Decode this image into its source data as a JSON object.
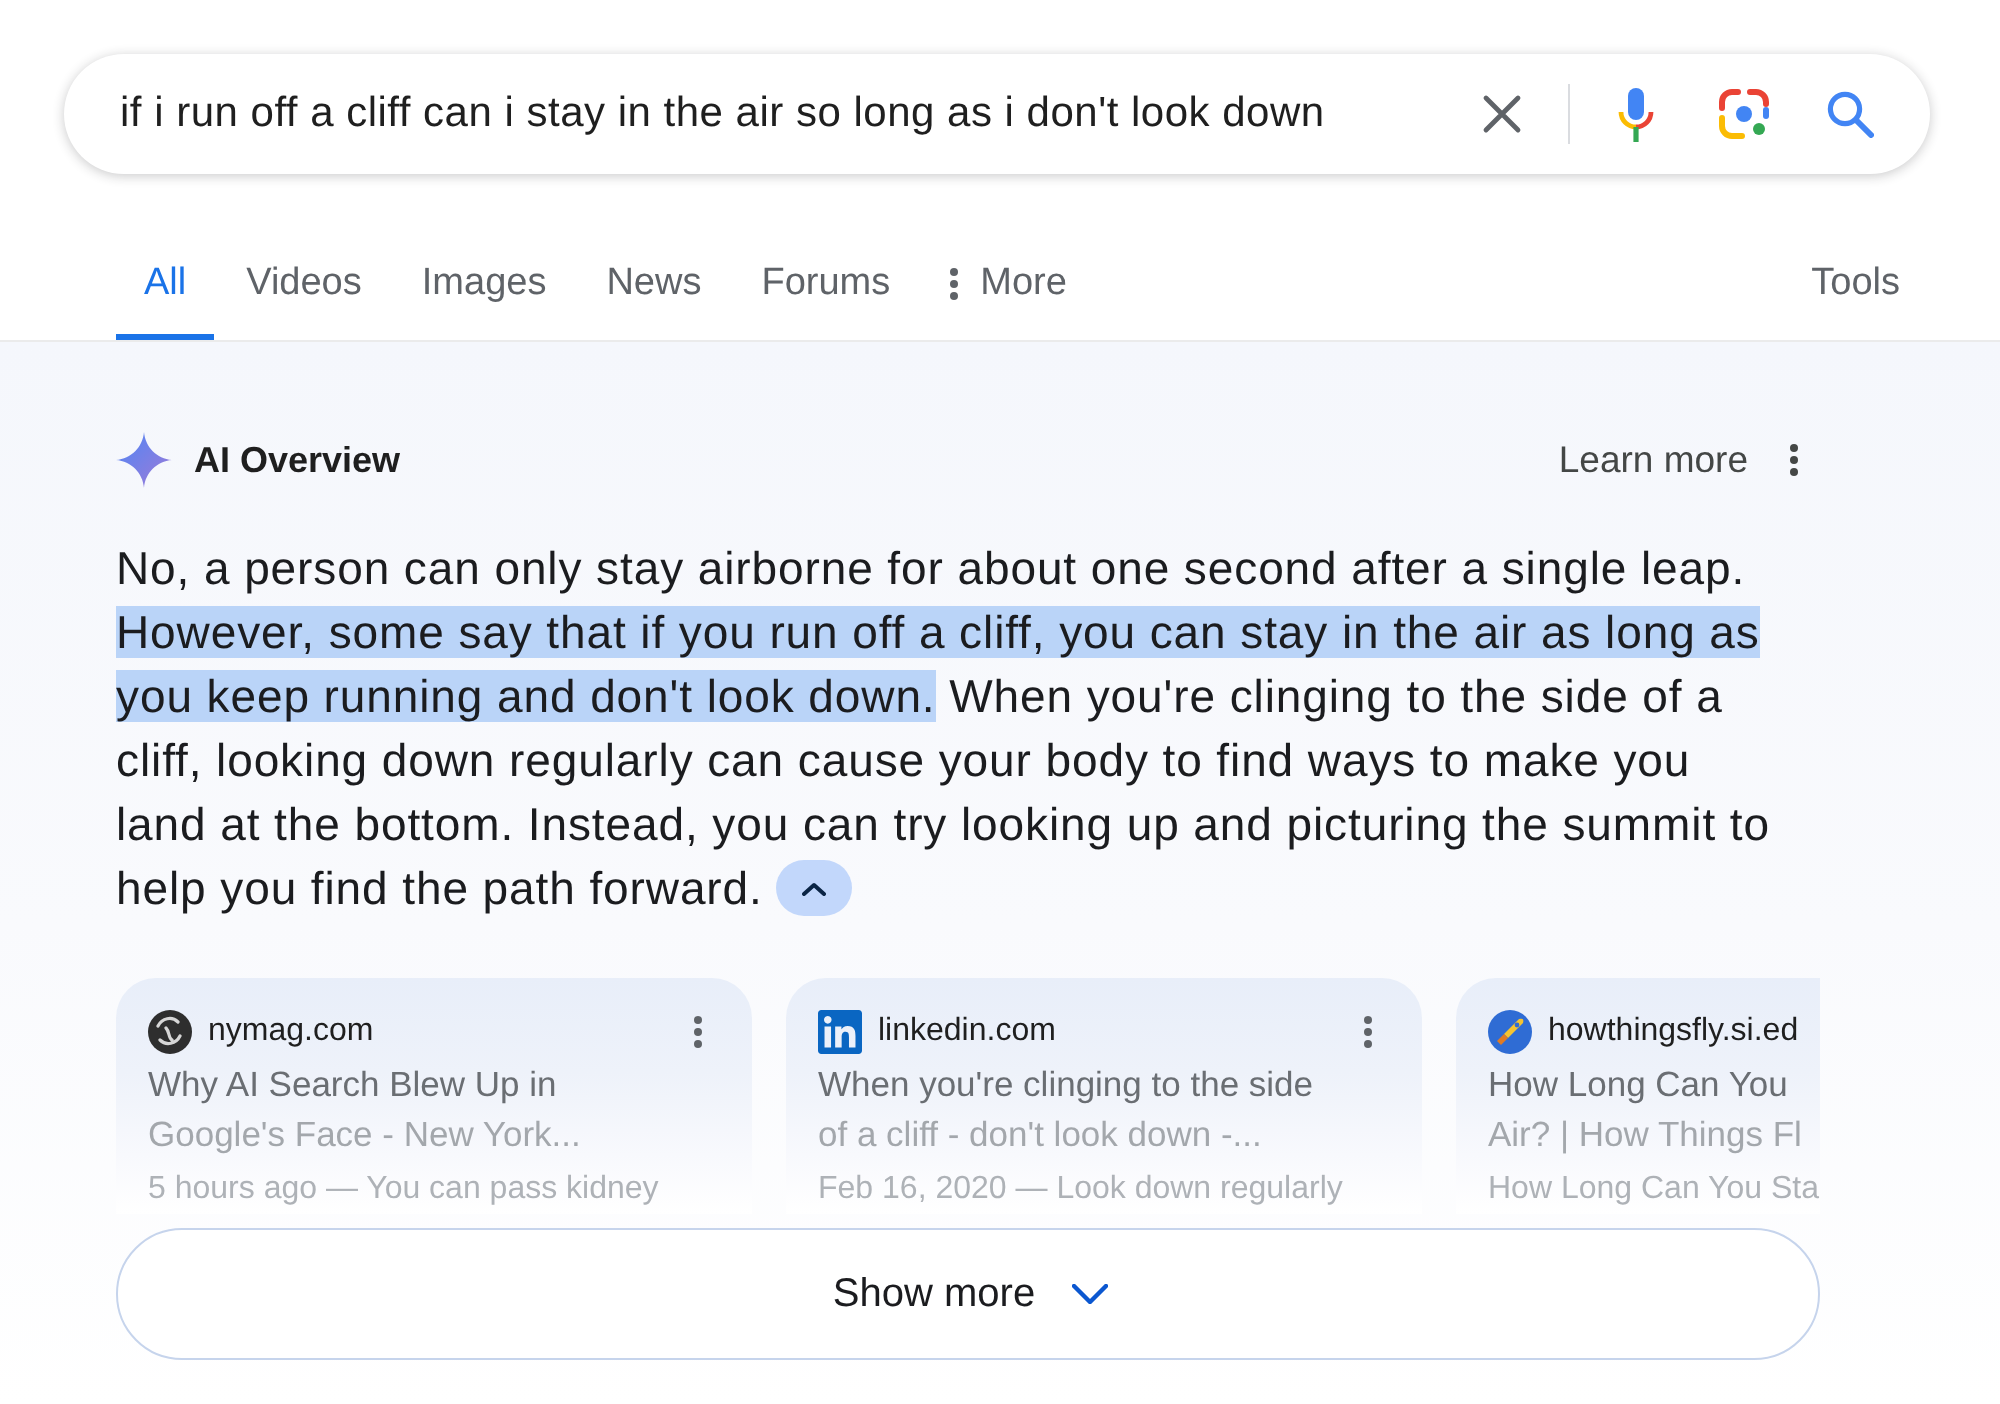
{
  "search": {
    "value": "if i run off a cliff can i stay in the air so long as i don't look down"
  },
  "tabs": [
    {
      "label": "All",
      "selected": true,
      "kind": "plain"
    },
    {
      "label": "Videos",
      "selected": false,
      "kind": "plain"
    },
    {
      "label": "Images",
      "selected": false,
      "kind": "plain"
    },
    {
      "label": "News",
      "selected": false,
      "kind": "plain"
    },
    {
      "label": "Forums",
      "selected": false,
      "kind": "plain"
    },
    {
      "label": "More",
      "selected": false,
      "kind": "menu"
    }
  ],
  "tools": "Tools",
  "overview": {
    "title": "AI Overview",
    "learn_more": "Learn more",
    "segments": [
      {
        "text": "No, a person can only stay airborne for about one second after a single leap.",
        "highlighted": false
      },
      {
        "text": "However, some say that if you run off a cliff, you can stay in the air as long as you keep running and don't look down.",
        "highlighted": true
      },
      {
        "text": "When you're clinging to the side of a cliff, looking down regularly can cause your body to find ways to make you land at the bottom. Instead, you can try looking up and picturing the summit to help you find the path forward.",
        "highlighted": false
      }
    ],
    "expanded": true
  },
  "sources": [
    {
      "site": "nymag.com",
      "title_lines": [
        "Why AI Search Blew Up in",
        "Google's Face - New York..."
      ],
      "snippet": "5 hours ago — You can pass kidney",
      "cut_off": false
    },
    {
      "site": "linkedin.com",
      "title_lines": [
        "When you're clinging to the side",
        "of a cliff - don't look down -..."
      ],
      "snippet": "Feb 16, 2020 — Look down regularly",
      "cut_off": false
    },
    {
      "site": "howthingsfly.si.ed",
      "title_lines": [
        "How Long Can You",
        "Air? | How Things Fl"
      ],
      "snippet": "How Long Can You Sta",
      "cut_off": true
    }
  ],
  "show_more": "Show more"
}
